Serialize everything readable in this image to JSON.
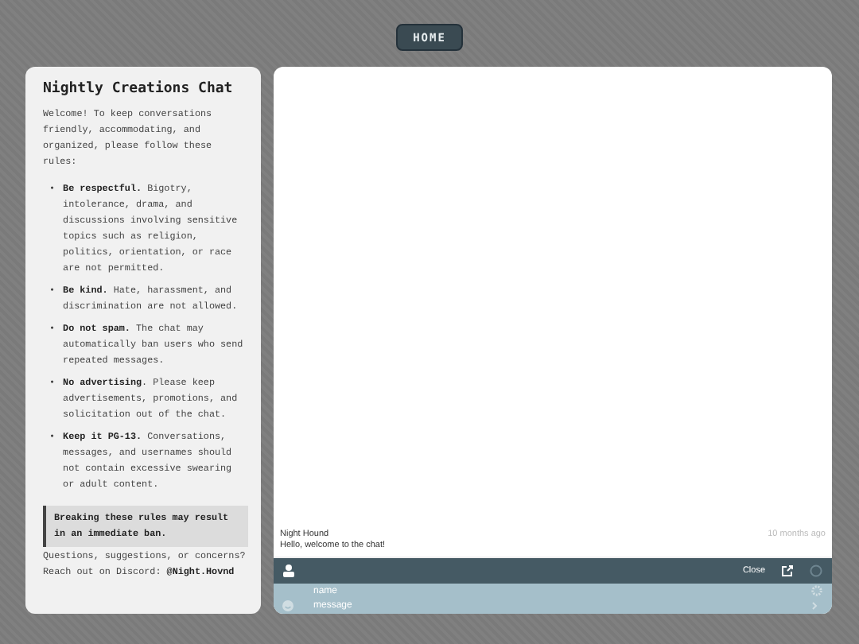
{
  "home_button": {
    "label": "HOME"
  },
  "rules_panel": {
    "title": "Nightly Creations Chat",
    "intro": "Welcome! To keep conversations friendly, accommodating, and organized, please follow these rules:",
    "rules": [
      {
        "marker": "•",
        "text": "**Be respectful.** Bigotry, intolerance, drama, and discussions involving sensitive topics such as religion, politics, orientation, or race are not permitted."
      },
      {
        "marker": "•",
        "text": "**Be kind.** Hate, harassment, and discrimination are not allowed."
      },
      {
        "marker": "•",
        "text": "**Do not spam.** The chat may automatically ban users who send repeated messages."
      },
      {
        "marker": "•",
        "text": "**No advertising**. Please keep advertisements, promotions, and solicitation out of the chat."
      },
      {
        "marker": "•",
        "text": "**Keep it PG-13.** Conversations, messages, and usernames should not contain excessive swearing or adult content."
      }
    ],
    "warning": "Breaking these rules may result in an immediate ban.",
    "contact": "Questions, suggestions, or concerns? Reach out on Discord: **@Night.Hovnd**"
  },
  "chat": {
    "messages": [
      {
        "author": "Night Hound",
        "time": "10 months ago",
        "text": "Hello, welcome to the chat!"
      }
    ],
    "toolbar": {
      "close_label": "Close"
    },
    "name_field": {
      "placeholder": "name"
    },
    "message_field": {
      "placeholder": "message"
    }
  }
}
